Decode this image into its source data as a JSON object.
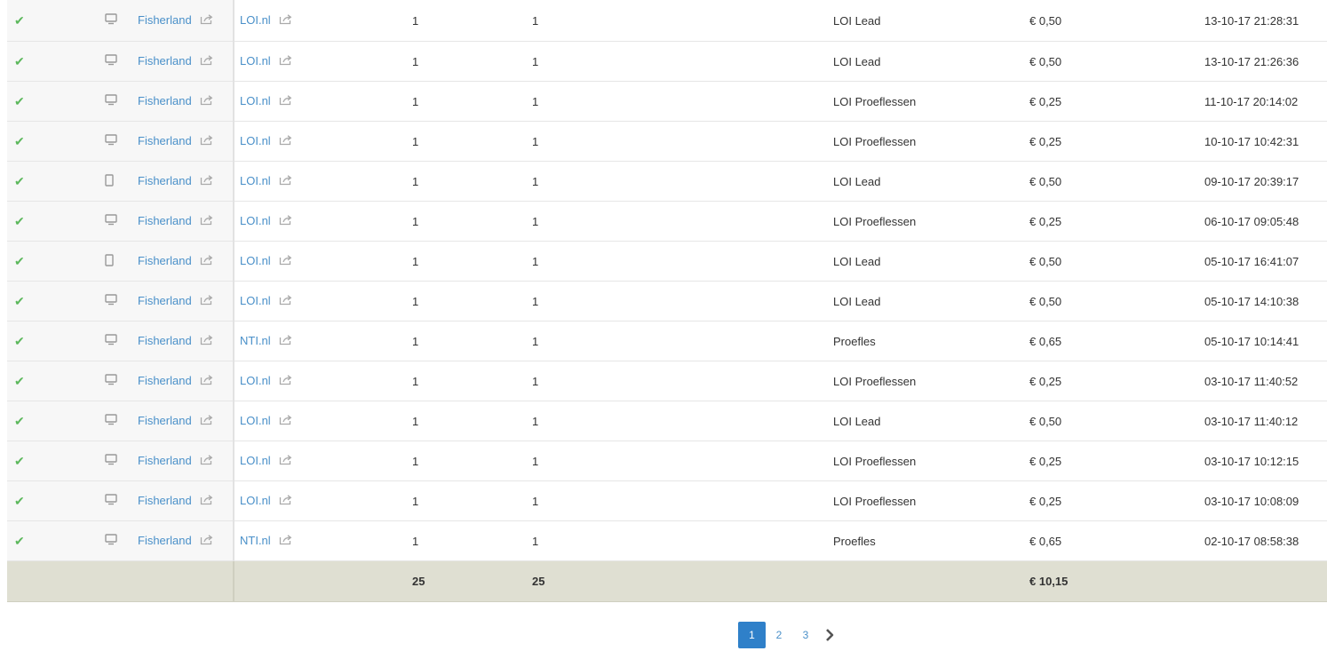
{
  "rows": [
    {
      "site": "Fisherland",
      "program": "LOI.nl",
      "clicks": "1",
      "leads": "1",
      "type": "LOI Lead",
      "amount": "€ 0,50",
      "date": "13-10-17 21:28:31",
      "device": "desktop"
    },
    {
      "site": "Fisherland",
      "program": "LOI.nl",
      "clicks": "1",
      "leads": "1",
      "type": "LOI Lead",
      "amount": "€ 0,50",
      "date": "13-10-17 21:26:36",
      "device": "desktop"
    },
    {
      "site": "Fisherland",
      "program": "LOI.nl",
      "clicks": "1",
      "leads": "1",
      "type": "LOI Proeflessen",
      "amount": "€ 0,25",
      "date": "11-10-17 20:14:02",
      "device": "desktop"
    },
    {
      "site": "Fisherland",
      "program": "LOI.nl",
      "clicks": "1",
      "leads": "1",
      "type": "LOI Proeflessen",
      "amount": "€ 0,25",
      "date": "10-10-17 10:42:31",
      "device": "desktop"
    },
    {
      "site": "Fisherland",
      "program": "LOI.nl",
      "clicks": "1",
      "leads": "1",
      "type": "LOI Lead",
      "amount": "€ 0,50",
      "date": "09-10-17 20:39:17",
      "device": "mobile"
    },
    {
      "site": "Fisherland",
      "program": "LOI.nl",
      "clicks": "1",
      "leads": "1",
      "type": "LOI Proeflessen",
      "amount": "€ 0,25",
      "date": "06-10-17 09:05:48",
      "device": "desktop"
    },
    {
      "site": "Fisherland",
      "program": "LOI.nl",
      "clicks": "1",
      "leads": "1",
      "type": "LOI Lead",
      "amount": "€ 0,50",
      "date": "05-10-17 16:41:07",
      "device": "mobile"
    },
    {
      "site": "Fisherland",
      "program": "LOI.nl",
      "clicks": "1",
      "leads": "1",
      "type": "LOI Lead",
      "amount": "€ 0,50",
      "date": "05-10-17 14:10:38",
      "device": "desktop"
    },
    {
      "site": "Fisherland",
      "program": "NTI.nl",
      "clicks": "1",
      "leads": "1",
      "type": "Proefles",
      "amount": "€ 0,65",
      "date": "05-10-17 10:14:41",
      "device": "desktop"
    },
    {
      "site": "Fisherland",
      "program": "LOI.nl",
      "clicks": "1",
      "leads": "1",
      "type": "LOI Proeflessen",
      "amount": "€ 0,25",
      "date": "03-10-17 11:40:52",
      "device": "desktop"
    },
    {
      "site": "Fisherland",
      "program": "LOI.nl",
      "clicks": "1",
      "leads": "1",
      "type": "LOI Lead",
      "amount": "€ 0,50",
      "date": "03-10-17 11:40:12",
      "device": "desktop"
    },
    {
      "site": "Fisherland",
      "program": "LOI.nl",
      "clicks": "1",
      "leads": "1",
      "type": "LOI Proeflessen",
      "amount": "€ 0,25",
      "date": "03-10-17 10:12:15",
      "device": "desktop"
    },
    {
      "site": "Fisherland",
      "program": "LOI.nl",
      "clicks": "1",
      "leads": "1",
      "type": "LOI Proeflessen",
      "amount": "€ 0,25",
      "date": "03-10-17 10:08:09",
      "device": "desktop"
    },
    {
      "site": "Fisherland",
      "program": "NTI.nl",
      "clicks": "1",
      "leads": "1",
      "type": "Proefles",
      "amount": "€ 0,65",
      "date": "02-10-17 08:58:38",
      "device": "desktop"
    }
  ],
  "totals": {
    "clicks": "25",
    "leads": "25",
    "amount": "€ 10,15"
  },
  "pagination": {
    "pages": [
      "1",
      "2",
      "3"
    ],
    "current": "1",
    "next_icon": "chevron-right-icon"
  },
  "icons": {
    "status": "check-icon",
    "desktop": "desktop-icon",
    "mobile": "mobile-icon",
    "external": "external-link-icon"
  },
  "colors": {
    "check": "#5cb85c",
    "link": "#4a90c9",
    "active_page": "#2f80c9",
    "total_bg": "#dfdfd2"
  }
}
